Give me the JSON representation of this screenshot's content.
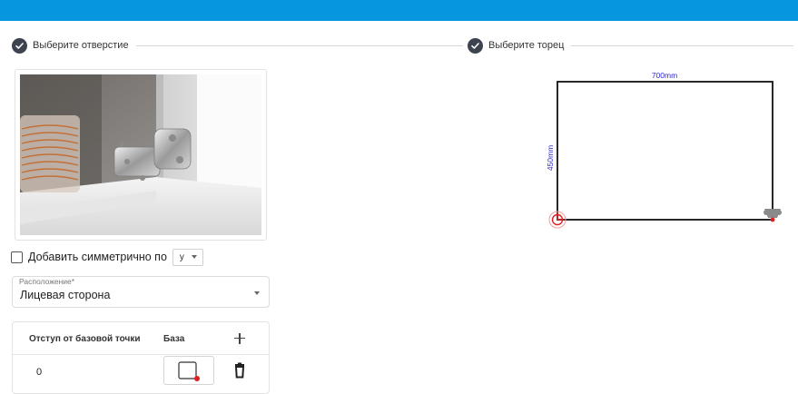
{
  "header": {
    "bar_color": "#0596df"
  },
  "steps": [
    {
      "label": "Выберите отверстие",
      "icon": "check-circle-icon"
    },
    {
      "label": "Выберите торец",
      "icon": "check-circle-icon"
    }
  ],
  "symmetry": {
    "label": "Добавить симметрично по",
    "checked": false,
    "axis_value": "y"
  },
  "placement": {
    "label": "Расположение",
    "required_mark": "*",
    "value": "Лицевая сторона"
  },
  "offsets_table": {
    "columns": [
      "Отступ от базовой точки",
      "База",
      "+"
    ],
    "rows": [
      {
        "offset": "0"
      }
    ]
  },
  "edge_view": {
    "width_label": "700mm",
    "height_label": "450mm",
    "dimension_color": "#2c26d6",
    "marker_color": "#e02020"
  }
}
